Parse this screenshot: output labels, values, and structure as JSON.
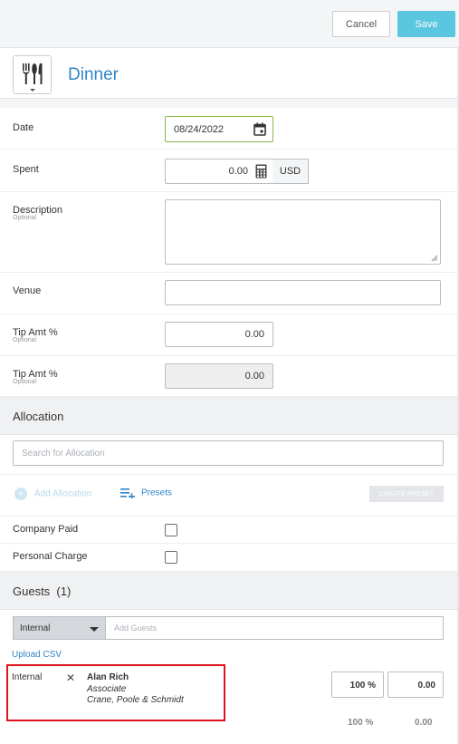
{
  "toolbar": {
    "cancel_label": "Cancel",
    "save_label": "Save"
  },
  "expense": {
    "category_icon": "fork-knife-spoon-icon",
    "title": "Dinner"
  },
  "fields": {
    "date": {
      "label": "Date",
      "value": "08/24/2022"
    },
    "spent": {
      "label": "Spent",
      "value": "0.00",
      "currency": "USD"
    },
    "description": {
      "label": "Description",
      "sublabel": "Optional",
      "value": ""
    },
    "venue": {
      "label": "Venue",
      "value": ""
    },
    "tip_amt_1": {
      "label": "Tip Amt %",
      "sublabel": "Optional",
      "value": "0.00"
    },
    "tip_amt_2": {
      "label": "Tip Amt %",
      "sublabel": "Optional",
      "value": "0.00"
    }
  },
  "allocation": {
    "heading": "Allocation",
    "search_placeholder": "Search for Allocation",
    "add_label": "Add Allocation",
    "presets_label": "Presets",
    "create_preset_label": "CREATE PRESET"
  },
  "flags": {
    "company_paid": {
      "label": "Company Paid",
      "checked": false
    },
    "personal_charge": {
      "label": "Personal Charge",
      "checked": false
    }
  },
  "guests": {
    "heading": "Guests",
    "count": "(1)",
    "type_selected": "Internal",
    "add_placeholder": "Add Guests",
    "upload_csv_label": "Upload CSV",
    "list": [
      {
        "type": "Internal",
        "name": "Alan Rich",
        "role": "Associate",
        "company": "Crane, Poole & Schmidt",
        "percent": "100 %",
        "amount": "0.00"
      }
    ],
    "total_percent": "100 %",
    "total_amount": "0.00"
  },
  "colors": {
    "accent_blue": "#2f86c8",
    "save_button": "#5bc6df",
    "date_border": "#86b84a",
    "highlight_red": "#e0121b"
  }
}
